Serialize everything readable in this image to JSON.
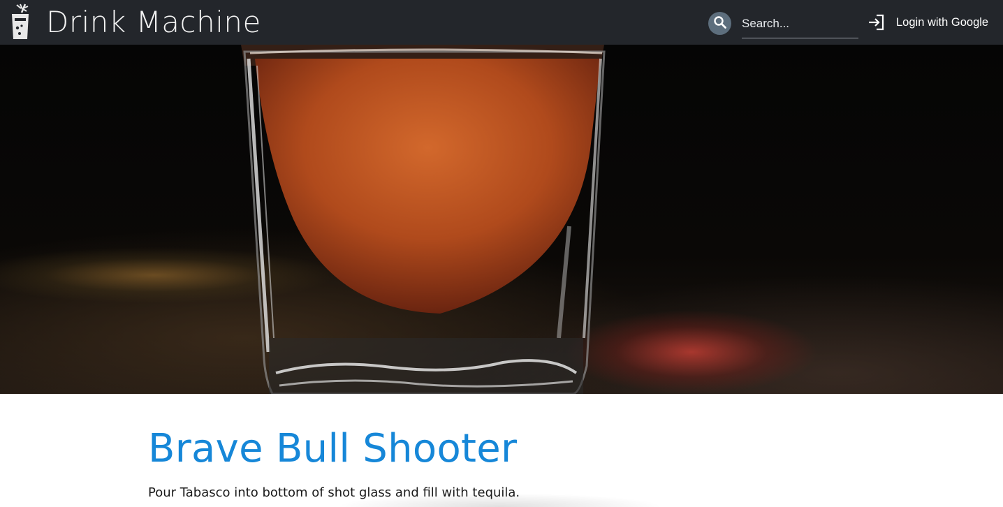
{
  "header": {
    "brand_name": "Drink Machine",
    "logo_icon": "cocktail-glass-icon",
    "search": {
      "icon": "search-icon",
      "placeholder": "Search..."
    },
    "login": {
      "icon": "login-icon",
      "label": "Login with Google"
    }
  },
  "hero": {
    "image_alt": "shot-glass-photo"
  },
  "drink": {
    "name": "Brave Bull Shooter",
    "instructions": "Pour Tabasco into bottom of shot glass and fill with tequila."
  },
  "colors": {
    "navbar_bg": "#23262b",
    "accent_blue": "#1687d8",
    "search_button": "#5d6e7d"
  }
}
